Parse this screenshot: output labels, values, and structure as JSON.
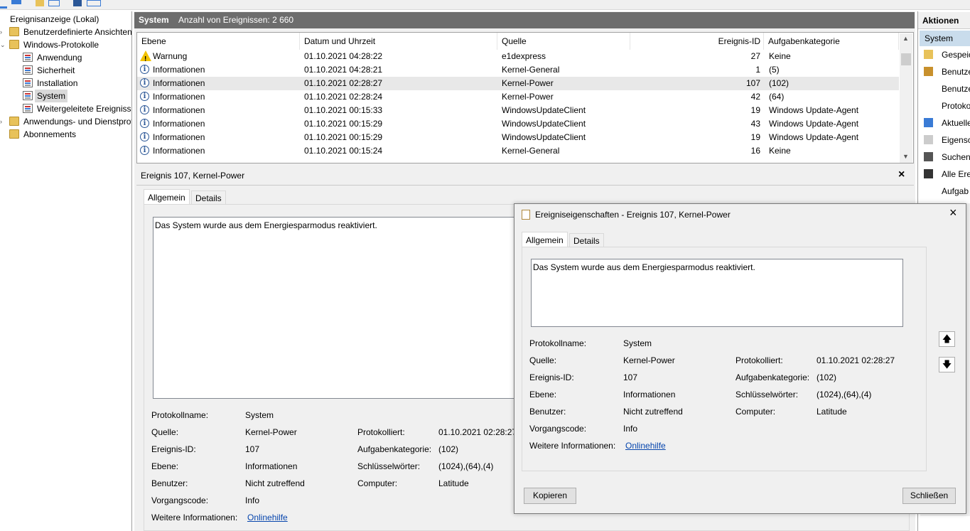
{
  "tree": {
    "items": [
      {
        "label": "Ereignisanzeige (Lokal)"
      },
      {
        "label": "Benutzerdefinierte Ansichten"
      },
      {
        "label": "Windows-Protokolle"
      },
      {
        "label": "Anwendung"
      },
      {
        "label": "Sicherheit"
      },
      {
        "label": "Installation"
      },
      {
        "label": "System"
      },
      {
        "label": "Weitergeleitete Ereignisse"
      },
      {
        "label": "Anwendungs- und Dienstprotokolle"
      },
      {
        "label": "Abonnements"
      }
    ]
  },
  "header": {
    "title": "System",
    "count_text": "Anzahl von Ereignissen: 2 660"
  },
  "grid": {
    "columns": [
      "Ebene",
      "Datum und Uhrzeit",
      "Quelle",
      "Ereignis-ID",
      "Aufgabenkategorie"
    ],
    "rows": [
      {
        "level": "Warnung",
        "date": "01.10.2021 04:28:22",
        "source": "e1dexpress",
        "id": "27",
        "category": "Keine"
      },
      {
        "level": "Informationen",
        "date": "01.10.2021 04:28:21",
        "source": "Kernel-General",
        "id": "1",
        "category": "(5)"
      },
      {
        "level": "Informationen",
        "date": "01.10.2021 02:28:27",
        "source": "Kernel-Power",
        "id": "107",
        "category": "(102)"
      },
      {
        "level": "Informationen",
        "date": "01.10.2021 02:28:24",
        "source": "Kernel-Power",
        "id": "42",
        "category": "(64)"
      },
      {
        "level": "Informationen",
        "date": "01.10.2021 00:15:33",
        "source": "WindowsUpdateClient",
        "id": "19",
        "category": "Windows Update-Agent"
      },
      {
        "level": "Informationen",
        "date": "01.10.2021 00:15:29",
        "source": "WindowsUpdateClient",
        "id": "43",
        "category": "Windows Update-Agent"
      },
      {
        "level": "Informationen",
        "date": "01.10.2021 00:15:29",
        "source": "WindowsUpdateClient",
        "id": "19",
        "category": "Windows Update-Agent"
      },
      {
        "level": "Informationen",
        "date": "01.10.2021 00:15:24",
        "source": "Kernel-General",
        "id": "16",
        "category": "Keine"
      }
    ]
  },
  "detail": {
    "title": "Ereignis 107, Kernel-Power",
    "tab_general": "Allgemein",
    "tab_details": "Details",
    "message": "Das System wurde aus dem Energiesparmodus reaktiviert.",
    "labels": {
      "log": "Protokollname:",
      "source": "Quelle:",
      "event_id": "Ereignis-ID:",
      "level": "Ebene:",
      "user": "Benutzer:",
      "opcode": "Vorgangscode:",
      "more_info": "Weitere Informationen:",
      "logged": "Protokolliert:",
      "task_category": "Aufgabenkategorie:",
      "keywords": "Schlüsselwörter:",
      "computer": "Computer:"
    },
    "values": {
      "log": "System",
      "source": "Kernel-Power",
      "event_id": "107",
      "level": "Informationen",
      "user": "Nicht zutreffend",
      "opcode": "Info",
      "more_info_link": "Onlinehilfe",
      "logged": "01.10.2021 02:28:27",
      "task_category": "(102)",
      "keywords": "(1024),(64),(4)",
      "computer": "Latitude"
    }
  },
  "actions": {
    "title": "Aktionen",
    "section": "System",
    "items": [
      "Gespeic",
      "Benutze",
      "Benutze",
      "Protoko",
      "Aktuelle",
      "Eigensc",
      "Suchen",
      "Alle Ere",
      "Aufgab"
    ]
  },
  "dialog": {
    "title": "Ereigniseigenschaften - Ereignis 107, Kernel-Power",
    "copy_button": "Kopieren",
    "close_button": "Schließen"
  }
}
